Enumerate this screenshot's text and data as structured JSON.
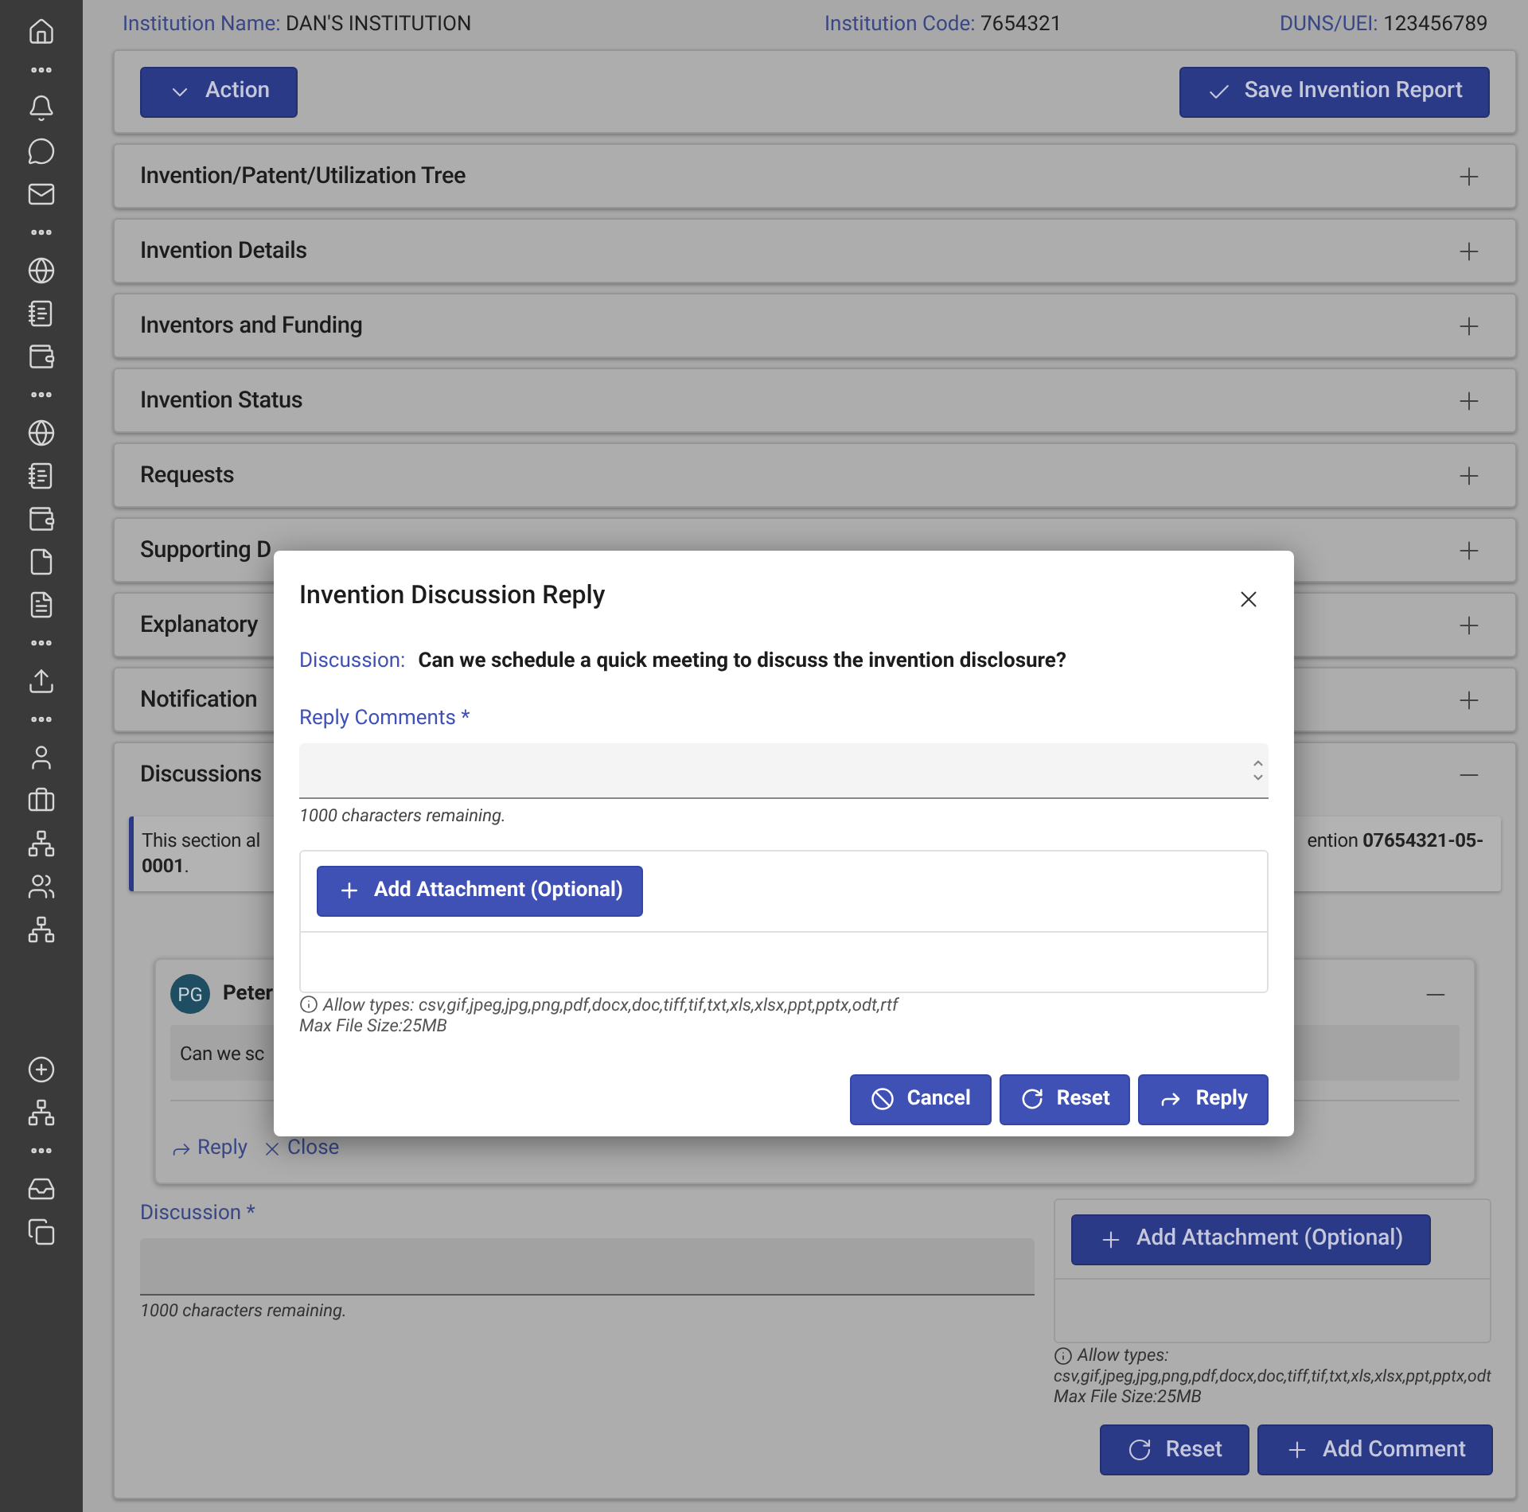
{
  "header": {
    "fields": [
      {
        "label": "Institution Name:",
        "value": "DAN'S INSTITUTION"
      },
      {
        "label": "Institution Code:",
        "value": "7654321"
      },
      {
        "label": "DUNS/UEI:",
        "value": "123456789"
      }
    ]
  },
  "toolbar": {
    "action_button": "Action",
    "save_button": "Save Invention Report"
  },
  "sections": [
    {
      "title": "Invention/Patent/Utilization Tree",
      "expanded": false
    },
    {
      "title": "Invention Details",
      "expanded": false
    },
    {
      "title": "Inventors and Funding",
      "expanded": false
    },
    {
      "title": "Invention Status",
      "expanded": false
    },
    {
      "title": "Requests",
      "expanded": false
    },
    {
      "title": "Supporting D",
      "expanded": false
    },
    {
      "title": "Explanatory",
      "expanded": false
    },
    {
      "title": "Notification",
      "expanded": false
    },
    {
      "title": "Discussions",
      "expanded": true
    }
  ],
  "discussions": {
    "notice": {
      "line1_start": "This section al",
      "line1_end": "ention **07654321-05-**",
      "line2": "**0001**."
    },
    "thread": {
      "avatar": "PG",
      "author": "Peter",
      "message": "Can we sc",
      "expanded": true,
      "actions": [
        "Reply",
        "Close"
      ]
    },
    "comment_field": {
      "label": "Discussion *",
      "counter": "1000 characters remaining."
    },
    "attachment": {
      "button": "Add Attachment (Optional)",
      "allow_label": "Allow types:",
      "allow_types": "csv,gif,jpeg,jpg,png,pdf,docx,doc,tiff,tif,txt,xls,xlsx,ppt,pptx,odt",
      "max_size": "Max File Size:25MB"
    },
    "buttons": [
      "Reset",
      "Add Comment"
    ]
  },
  "modal": {
    "title": "Invention Discussion Reply",
    "discussion_label": "Discussion:",
    "discussion_text": "Can we schedule a quick meeting to discuss the invention disclosure?",
    "reply_label": "Reply Comments *",
    "counter": "1000 characters remaining.",
    "attachment_button": "Add Attachment (Optional)",
    "allow_types": "Allow types: csv,gif,jpeg,jpg,png,pdf,docx,doc,tiff,tif,txt,xls,xlsx,ppt,pptx,odt,rtf",
    "max_size": "Max File Size:25MB",
    "buttons": [
      "Cancel",
      "Reset",
      "Reply"
    ]
  }
}
